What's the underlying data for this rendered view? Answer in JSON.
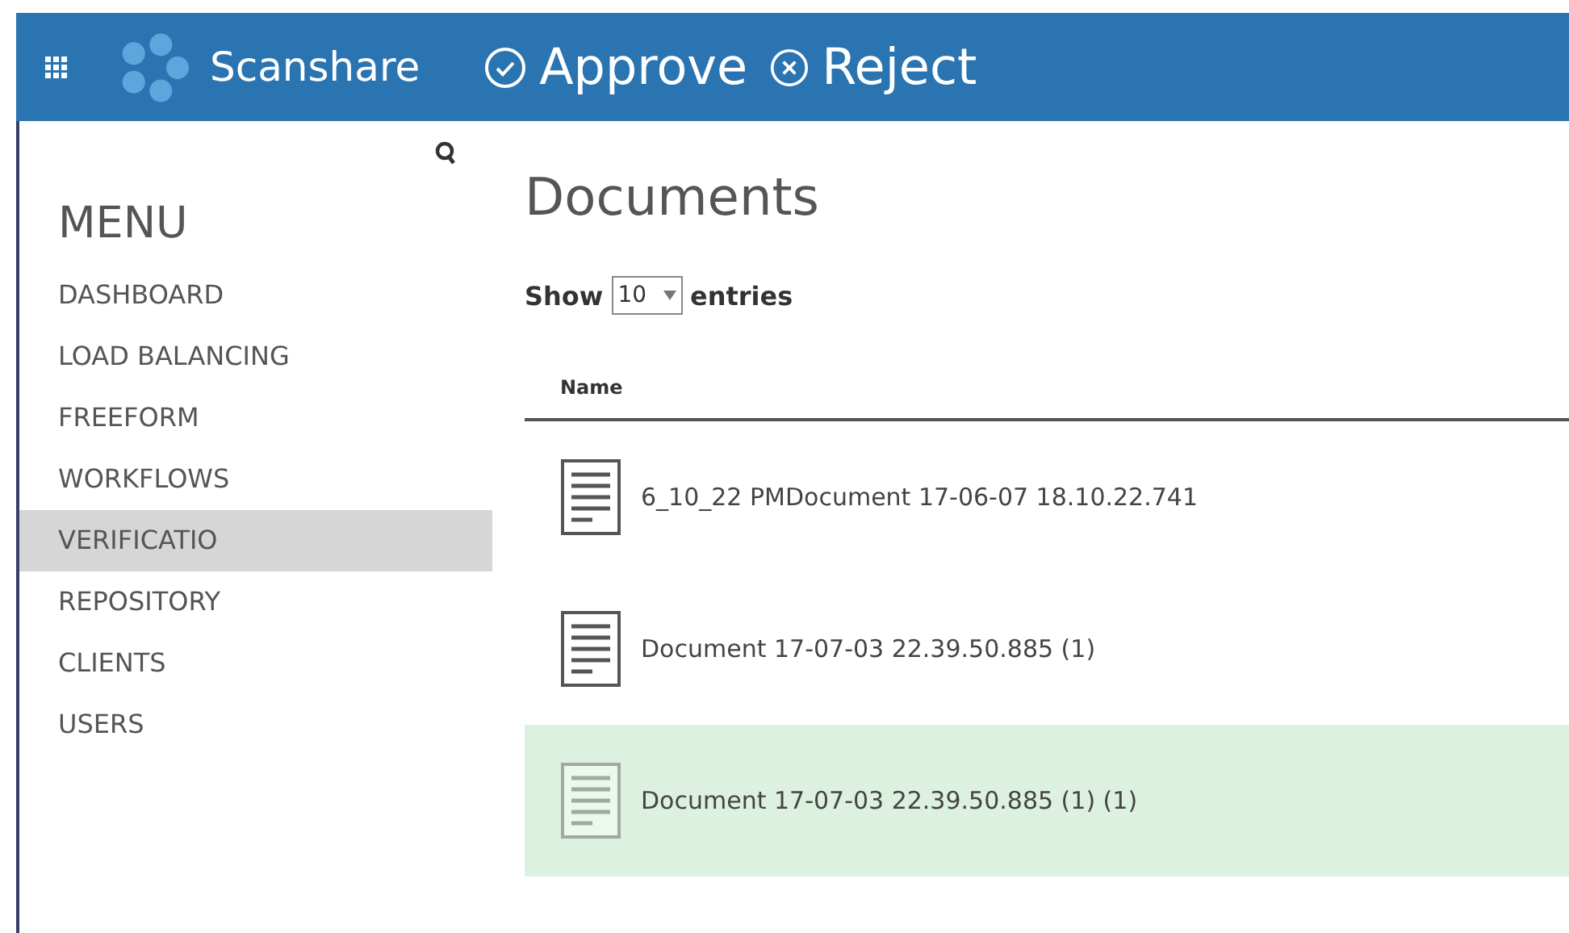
{
  "header": {
    "brand": "Scanshare",
    "actions": [
      {
        "kind": "approve",
        "label": "Approve"
      },
      {
        "kind": "reject",
        "label": "Reject"
      }
    ]
  },
  "sidebar": {
    "title": "MENU",
    "items": [
      {
        "label": "DASHBOARD",
        "selected": false
      },
      {
        "label": "LOAD BALANCING",
        "selected": false
      },
      {
        "label": "FREEFORM",
        "selected": false
      },
      {
        "label": "WORKFLOWS",
        "selected": false
      },
      {
        "label": "VERIFICATIO",
        "selected": true
      },
      {
        "label": "REPOSITORY",
        "selected": false
      },
      {
        "label": "CLIENTS",
        "selected": false
      },
      {
        "label": "USERS",
        "selected": false
      }
    ]
  },
  "main": {
    "title": "Documents",
    "show_label": "Show",
    "page_size": "10",
    "entries_label": "entries",
    "table": {
      "columns": [
        "Name"
      ],
      "rows": [
        {
          "name": "6_10_22 PMDocument 17-06-07 18.10.22.741",
          "selected": false
        },
        {
          "name": "Document 17-07-03 22.39.50.885 (1)",
          "selected": false
        },
        {
          "name": "Document 17-07-03 22.39.50.885 (1) (1)",
          "selected": true
        }
      ]
    }
  }
}
